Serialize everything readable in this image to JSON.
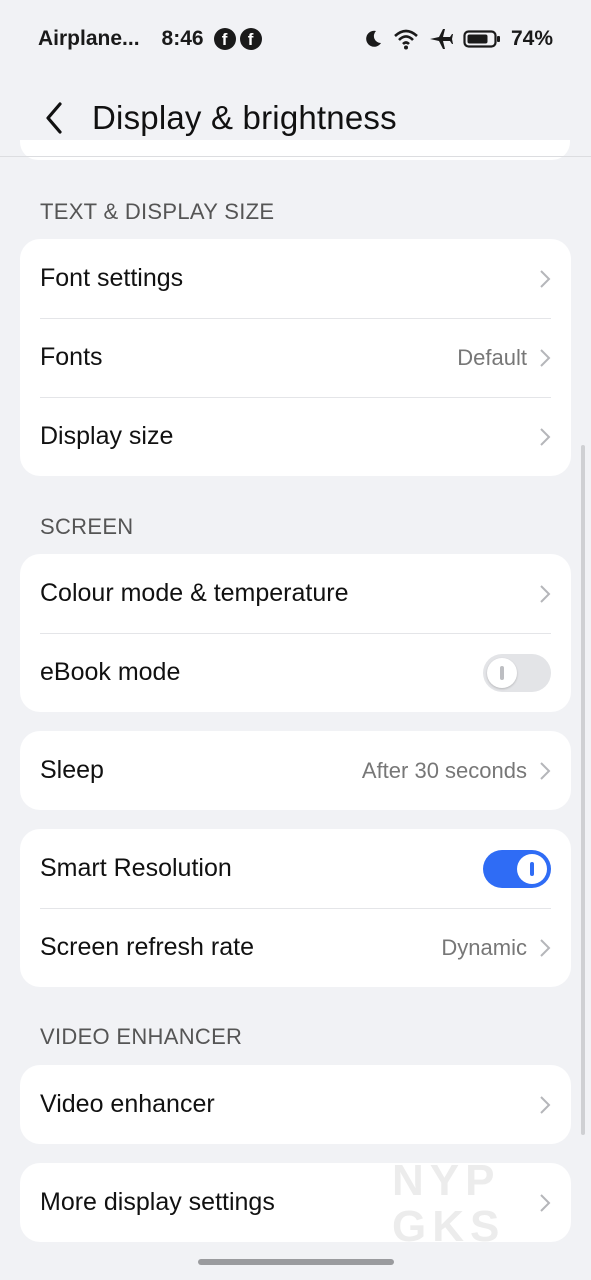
{
  "status_bar": {
    "mode": "Airplane...",
    "time": "8:46",
    "battery": "74%",
    "icons": [
      "facebook-icon",
      "facebook-icon",
      "moon-icon",
      "wifi-icon",
      "airplane-icon",
      "battery-icon"
    ]
  },
  "header": {
    "title": "Display & brightness",
    "back_icon": "back-arrow-icon"
  },
  "sections": {
    "text_display_size": {
      "label": "TEXT & DISPLAY SIZE",
      "rows": [
        {
          "label": "Font settings",
          "value": ""
        },
        {
          "label": "Fonts",
          "value": "Default"
        },
        {
          "label": "Display size",
          "value": ""
        }
      ]
    },
    "screen": {
      "label": "SCREEN",
      "rows": [
        {
          "label": "Colour mode & temperature",
          "value": ""
        },
        {
          "label": "eBook mode",
          "toggle": "off"
        }
      ]
    },
    "sleep": {
      "rows": [
        {
          "label": "Sleep",
          "value": "After 30 seconds"
        }
      ]
    },
    "resolution": {
      "rows": [
        {
          "label": "Smart Resolution",
          "toggle": "on"
        },
        {
          "label": "Screen refresh rate",
          "value": "Dynamic"
        }
      ]
    },
    "video_enhancer": {
      "label": "VIDEO ENHANCER",
      "rows": [
        {
          "label": "Video enhancer",
          "value": ""
        }
      ]
    },
    "more": {
      "rows": [
        {
          "label": "More display settings",
          "value": ""
        }
      ]
    }
  },
  "watermark": {
    "line1": "NYP",
    "line2": "GKS"
  },
  "colors": {
    "accent": "#2f6cf5",
    "background": "#f1f2f5",
    "card": "#ffffff"
  }
}
